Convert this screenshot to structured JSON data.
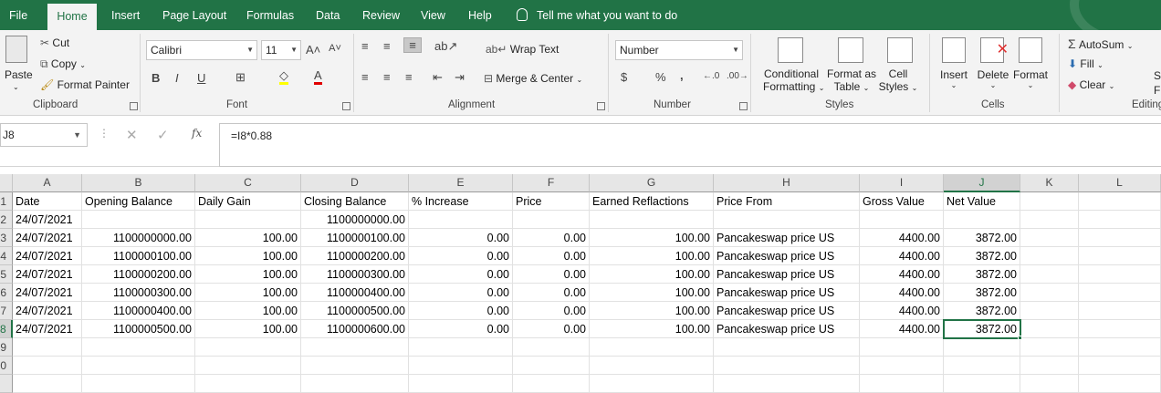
{
  "tabs": [
    "File",
    "Home",
    "Insert",
    "Page Layout",
    "Formulas",
    "Data",
    "Review",
    "View",
    "Help"
  ],
  "tell_me": "Tell me what you want to do",
  "ribbon": {
    "clipboard": {
      "paste": "Paste",
      "cut": "Cut",
      "copy": "Copy",
      "format_painter": "Format Painter",
      "label": "Clipboard"
    },
    "font": {
      "name": "Calibri",
      "size": "11",
      "bold": "B",
      "italic": "I",
      "underline": "U",
      "label": "Font"
    },
    "alignment": {
      "wrap_text": "Wrap Text",
      "merge_center": "Merge & Center",
      "label": "Alignment"
    },
    "number": {
      "format": "Number",
      "currency": "$",
      "percent": "%",
      "comma": ",",
      "label": "Number"
    },
    "styles": {
      "conditional_1": "Conditional",
      "conditional_2": "Formatting",
      "format_table_1": "Format as",
      "format_table_2": "Table",
      "cell_styles_1": "Cell",
      "cell_styles_2": "Styles",
      "label": "Styles"
    },
    "cells": {
      "insert": "Insert",
      "delete": "Delete",
      "format": "Format",
      "label": "Cells"
    },
    "editing": {
      "autosum": "AutoSum",
      "fill": "Fill",
      "clear": "Clear",
      "sort_1": "S",
      "sort_2": "Fi",
      "label": "Editing"
    }
  },
  "formula_bar": {
    "name_box": "J8",
    "formula": "=I8*0.88"
  },
  "columns": [
    "A",
    "B",
    "C",
    "D",
    "E",
    "F",
    "G",
    "H",
    "I",
    "J",
    "K",
    "L"
  ],
  "row_numbers": [
    "1",
    "2",
    "3",
    "4",
    "5",
    "6",
    "7",
    "8",
    "9",
    "0",
    ""
  ],
  "headers": [
    "Date",
    "Opening Balance",
    "Daily Gain",
    "Closing Balance",
    "% Increase",
    "Price",
    "Earned Reflactions",
    "Price From",
    "Gross Value",
    "Net Value"
  ],
  "rows": [
    [
      "24/07/2021",
      "",
      "",
      "1100000000.00",
      "",
      "",
      "",
      "",
      "",
      ""
    ],
    [
      "24/07/2021",
      "1100000000.00",
      "100.00",
      "1100000100.00",
      "0.00",
      "0.00",
      "100.00",
      " Pancakeswap price US",
      "4400.00",
      "3872.00"
    ],
    [
      "24/07/2021",
      "1100000100.00",
      "100.00",
      "1100000200.00",
      "0.00",
      "0.00",
      "100.00",
      "Pancakeswap price US",
      "4400.00",
      "3872.00"
    ],
    [
      "24/07/2021",
      "1100000200.00",
      "100.00",
      "1100000300.00",
      "0.00",
      "0.00",
      "100.00",
      "Pancakeswap price US",
      "4400.00",
      "3872.00"
    ],
    [
      "24/07/2021",
      "1100000300.00",
      "100.00",
      "1100000400.00",
      "0.00",
      "0.00",
      "100.00",
      "Pancakeswap price US",
      "4400.00",
      "3872.00"
    ],
    [
      "24/07/2021",
      "1100000400.00",
      "100.00",
      "1100000500.00",
      "0.00",
      "0.00",
      "100.00",
      "Pancakeswap price US",
      "4400.00",
      "3872.00"
    ],
    [
      "24/07/2021",
      "1100000500.00",
      "100.00",
      "1100000600.00",
      "0.00",
      "0.00",
      "100.00",
      "Pancakeswap price US",
      "4400.00",
      "3872.00"
    ]
  ],
  "accent_color": "#217346"
}
